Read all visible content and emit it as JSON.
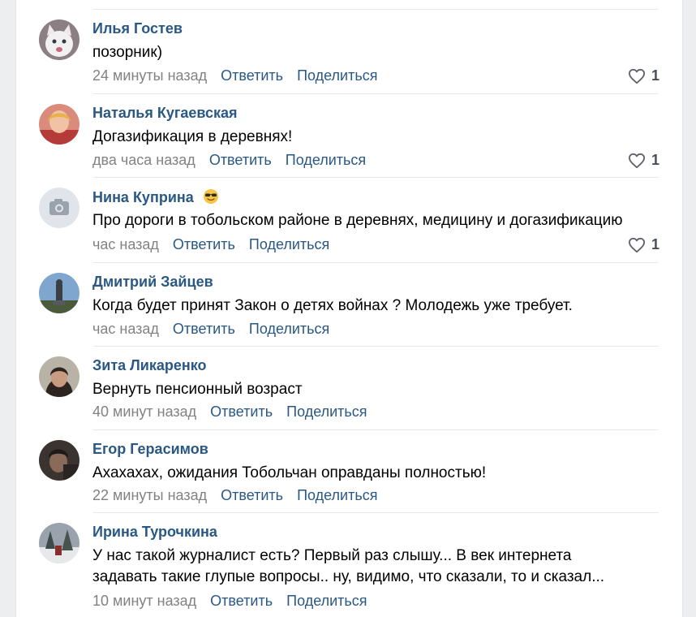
{
  "comments": [
    {
      "author": "Илья Гостев",
      "text": "позорник)",
      "time": "24 минуты назад",
      "reply": "Ответить",
      "share": "Поделиться",
      "likes": "1",
      "avatar": "avatar-white-cat"
    },
    {
      "author": "Наталья Кугаевская",
      "text": "Догазификация в деревнях!",
      "time": "два часа назад",
      "reply": "Ответить",
      "share": "Поделиться",
      "likes": "1",
      "avatar": "avatar-woman-red"
    },
    {
      "author": "Нина Куприна",
      "emoji": "sunglasses-emoji",
      "text": "Про дороги в тобольском районе в деревнях, медицину и догазификацию",
      "time": "час назад",
      "reply": "Ответить",
      "share": "Поделиться",
      "likes": "1",
      "avatar": "camera-placeholder-icon"
    },
    {
      "author": "Дмитрий Зайцев",
      "text": "Когда будет принят Закон о детях войнах ? Молодежь уже требует.",
      "time": "час назад",
      "reply": "Ответить",
      "share": "Поделиться",
      "avatar": "avatar-monument"
    },
    {
      "author": "Зита Ликаренко",
      "text": "Вернуть пенсионный возраст",
      "time": "40 минут назад",
      "reply": "Ответить",
      "share": "Поделиться",
      "avatar": "avatar-woman-dark"
    },
    {
      "author": "Егор Герасимов",
      "text": "Ахахахах, ожидания Тобольчан оправданы полностью!",
      "time": "22 минуты назад",
      "reply": "Ответить",
      "share": "Поделиться",
      "avatar": "avatar-man-dark"
    },
    {
      "author": "Ирина Турочкина",
      "text_line1": "У нас такой журналист есть? Первый раз слышу... В век интернета",
      "text_line2": "задавать такие глупые вопросы.. ну, видимо, что сказали, то и сказал...",
      "time": "10 минут назад",
      "reply": "Ответить",
      "share": "Поделиться",
      "avatar": "avatar-winter-forest"
    }
  ],
  "colors": {
    "author": "#2a5885",
    "link": "#2a5885",
    "time": "#828282",
    "like_heart": "#5d6169"
  }
}
